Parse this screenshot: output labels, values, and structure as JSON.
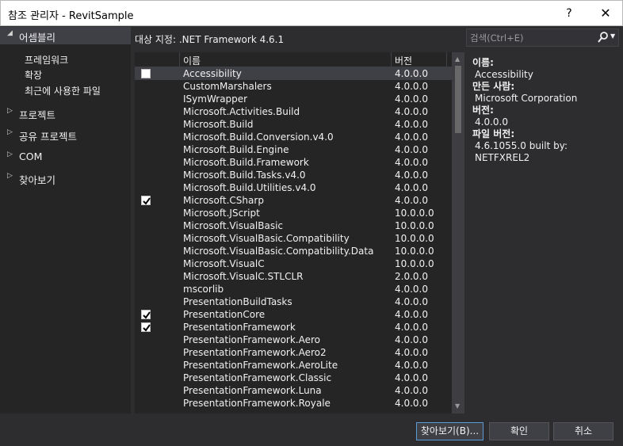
{
  "window": {
    "title": "참조 관리자 - RevitSample",
    "help": "?",
    "close": "✕"
  },
  "sidebar": {
    "assemblies": {
      "label": "어셈블리",
      "arrow": "◢"
    },
    "sub_items": [
      "프레임워크",
      "확장",
      "최근에 사용한 파일"
    ],
    "sections": [
      {
        "label": "프로젝트",
        "arrow": "▷"
      },
      {
        "label": "공유 프로젝트",
        "arrow": "▷"
      },
      {
        "label": "COM",
        "arrow": "▷"
      },
      {
        "label": "찾아보기",
        "arrow": "▷"
      }
    ]
  },
  "target_framework": "대상 지정: .NET Framework 4.6.1",
  "search": {
    "placeholder": "검색(Ctrl+E)",
    "icon": "search-icon"
  },
  "list": {
    "headers": {
      "name": "이름",
      "version": "버전"
    },
    "rows": [
      {
        "name": "Accessibility",
        "version": "4.0.0.0",
        "checked": false,
        "selected": true
      },
      {
        "name": "CustomMarshalers",
        "version": "4.0.0.0",
        "checked": false
      },
      {
        "name": "ISymWrapper",
        "version": "4.0.0.0",
        "checked": false
      },
      {
        "name": "Microsoft.Activities.Build",
        "version": "4.0.0.0",
        "checked": false
      },
      {
        "name": "Microsoft.Build",
        "version": "4.0.0.0",
        "checked": false
      },
      {
        "name": "Microsoft.Build.Conversion.v4.0",
        "version": "4.0.0.0",
        "checked": false
      },
      {
        "name": "Microsoft.Build.Engine",
        "version": "4.0.0.0",
        "checked": false
      },
      {
        "name": "Microsoft.Build.Framework",
        "version": "4.0.0.0",
        "checked": false
      },
      {
        "name": "Microsoft.Build.Tasks.v4.0",
        "version": "4.0.0.0",
        "checked": false
      },
      {
        "name": "Microsoft.Build.Utilities.v4.0",
        "version": "4.0.0.0",
        "checked": false
      },
      {
        "name": "Microsoft.CSharp",
        "version": "4.0.0.0",
        "checked": true
      },
      {
        "name": "Microsoft.JScript",
        "version": "10.0.0.0",
        "checked": false
      },
      {
        "name": "Microsoft.VisualBasic",
        "version": "10.0.0.0",
        "checked": false
      },
      {
        "name": "Microsoft.VisualBasic.Compatibility",
        "version": "10.0.0.0",
        "checked": false
      },
      {
        "name": "Microsoft.VisualBasic.Compatibility.Data",
        "version": "10.0.0.0",
        "checked": false
      },
      {
        "name": "Microsoft.VisualC",
        "version": "10.0.0.0",
        "checked": false
      },
      {
        "name": "Microsoft.VisualC.STLCLR",
        "version": "2.0.0.0",
        "checked": false
      },
      {
        "name": "mscorlib",
        "version": "4.0.0.0",
        "checked": false
      },
      {
        "name": "PresentationBuildTasks",
        "version": "4.0.0.0",
        "checked": false
      },
      {
        "name": "PresentationCore",
        "version": "4.0.0.0",
        "checked": true
      },
      {
        "name": "PresentationFramework",
        "version": "4.0.0.0",
        "checked": true
      },
      {
        "name": "PresentationFramework.Aero",
        "version": "4.0.0.0",
        "checked": false
      },
      {
        "name": "PresentationFramework.Aero2",
        "version": "4.0.0.0",
        "checked": false
      },
      {
        "name": "PresentationFramework.AeroLite",
        "version": "4.0.0.0",
        "checked": false
      },
      {
        "name": "PresentationFramework.Classic",
        "version": "4.0.0.0",
        "checked": false
      },
      {
        "name": "PresentationFramework.Luna",
        "version": "4.0.0.0",
        "checked": false
      },
      {
        "name": "PresentationFramework.Royale",
        "version": "4.0.0.0",
        "checked": false
      }
    ]
  },
  "details": {
    "name_label": "이름:",
    "name_value": "Accessibility",
    "author_label": "만든 사람:",
    "author_value": "Microsoft Corporation",
    "version_label": "버전:",
    "version_value": "4.0.0.0",
    "file_version_label": "파일 버전:",
    "file_version_value": "4.6.1055.0 built by: NETFXREL2"
  },
  "buttons": {
    "browse": "찾아보기(B)...",
    "ok": "확인",
    "cancel": "취소"
  },
  "colors": {
    "background": "#2d2d30",
    "panel": "#252526",
    "selection": "#3f3f46",
    "accent": "#5b9bd5"
  }
}
